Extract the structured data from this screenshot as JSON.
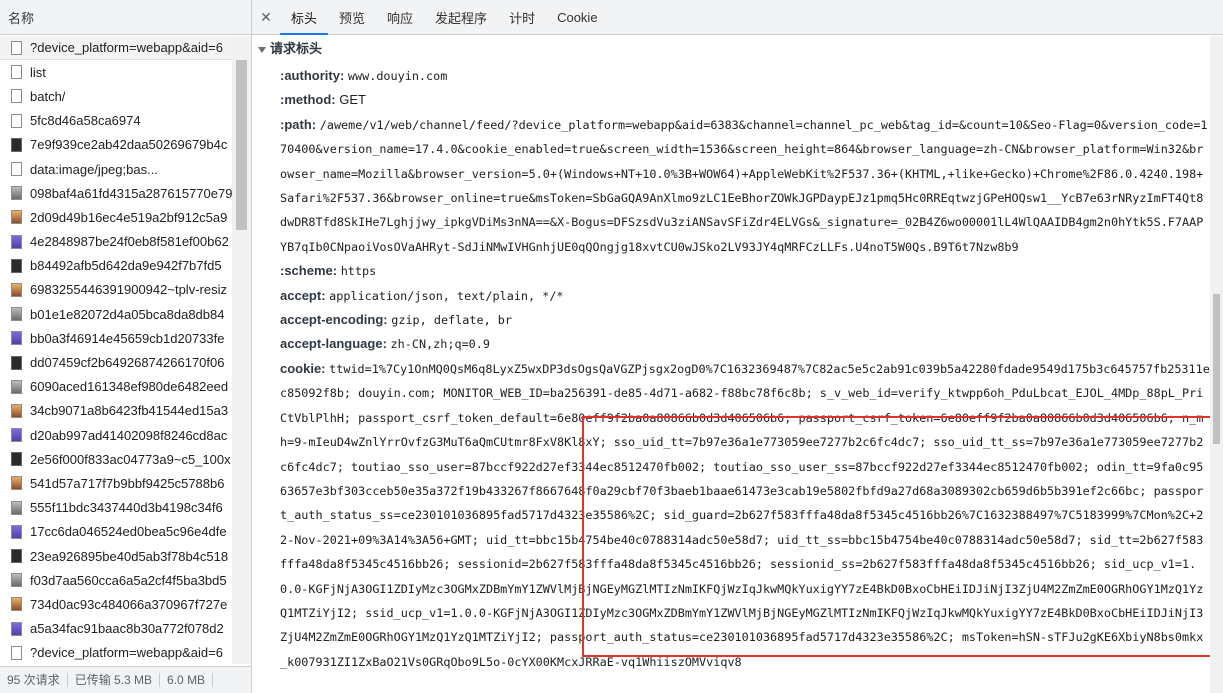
{
  "left": {
    "header": "名称",
    "requests": [
      {
        "name": "?device_platform=webapp&aid=6",
        "icon": "doc-icon"
      },
      {
        "name": "list",
        "icon": "doc-icon"
      },
      {
        "name": "batch/",
        "icon": "doc-icon"
      },
      {
        "name": "5fc8d46a58ca6974",
        "icon": "doc-icon"
      },
      {
        "name": "7e9f939ce2ab42daa50269679b4c",
        "icon": "script-icon"
      },
      {
        "name": "data:image/jpeg;bas...",
        "icon": "doc-icon"
      },
      {
        "name": "098baf4a61fd4315a287615770e79",
        "icon": "image-icon"
      },
      {
        "name": "2d09d49b16ec4e519a2bf912c5a9",
        "icon": "image-icon"
      },
      {
        "name": "4e2848987be24f0eb8f581ef00b62",
        "icon": "image-icon"
      },
      {
        "name": "b84492afb5d642da9e942f7b7fd5",
        "icon": "image-icon"
      },
      {
        "name": "6983255446391900942~tplv-resiz",
        "icon": "image-icon"
      },
      {
        "name": "b01e1e82072d4a05bca8da8db84",
        "icon": "image-icon"
      },
      {
        "name": "bb0a3f46914e45659cb1d20733fe",
        "icon": "image-icon"
      },
      {
        "name": "dd07459cf2b64926874266170f06",
        "icon": "image-icon"
      },
      {
        "name": "6090aced161348ef980de6482eed",
        "icon": "image-icon"
      },
      {
        "name": "34cb9071a8b6423fb41544ed15a3",
        "icon": "image-icon"
      },
      {
        "name": "d20ab997ad41402098f8246cd8ac",
        "icon": "image-icon"
      },
      {
        "name": "2e56f000f833ac04773a9~c5_100x",
        "icon": "image-icon"
      },
      {
        "name": "541d57a717f7b9bbf9425c5788b6",
        "icon": "image-icon"
      },
      {
        "name": "555f11bdc3437440d3b4198c34f6",
        "icon": "image-icon"
      },
      {
        "name": "17cc6da046524ed0bea5c96e4dfe",
        "icon": "image-icon"
      },
      {
        "name": "23ea926895be40d5ab3f78b4c518",
        "icon": "image-icon"
      },
      {
        "name": "f03d7aa560cca6a5a2cf4f5ba3bd5",
        "icon": "image-icon"
      },
      {
        "name": "734d0ac93c484066a370967f727e",
        "icon": "image-icon"
      },
      {
        "name": "a5a34fac91baac8b30a772f078d2",
        "icon": "image-icon"
      },
      {
        "name": "?device_platform=webapp&aid=6",
        "icon": "doc-icon"
      },
      {
        "name": "",
        "icon": "doc-icon"
      }
    ],
    "status": {
      "requests": "95 次请求",
      "transferred": "已传输 5.3 MB",
      "resources": "6.0 MB"
    }
  },
  "tabs": {
    "close": "✕",
    "items": [
      "标头",
      "预览",
      "响应",
      "发起程序",
      "计时",
      "Cookie"
    ],
    "active": "标头"
  },
  "section_title": "请求标头",
  "headers": [
    {
      "key": ":authority:",
      "value": "www.douyin.com",
      "mono": true
    },
    {
      "key": ":method:",
      "value": "GET",
      "mono": false
    },
    {
      "key": ":path:",
      "value": "/aweme/v1/web/channel/feed/?device_platform=webapp&aid=6383&channel=channel_pc_web&tag_id=&count=10&Seo-Flag=0&version_code=170400&version_name=17.4.0&cookie_enabled=true&screen_width=1536&screen_height=864&browser_language=zh-CN&browser_platform=Win32&browser_name=Mozilla&browser_version=5.0+(Windows+NT+10.0%3B+WOW64)+AppleWebKit%2F537.36+(KHTML,+like+Gecko)+Chrome%2F86.0.4240.198+Safari%2F537.36&browser_online=true&msToken=SbGaGQA9AnXlmo9zLC1EeBhorZOWkJGPDaypEJz1pmq5Hc0RREqtwzjGPeHOQsw1__YcB7e63rNRyzImFT4Qt8dwDR8Tfd8SkIHe7Lghjjwy_ipkgVDiMs3nNA==&X-Bogus=DFSzsdVu3ziANSavSFiZdr4ELVGs&_signature=_02B4Z6wo00001lL4WlQAAIDB4gm2n0hYtk5S.F7AAPYB7qIb0CNpaoiVosOVaAHRyt-SdJiNMwIVHGnhjUE0qQOngjg18xvtCU0wJSko2LV93JY4qMRFCzLLFs.U4noT5W0Qs.B9T6t7Nzw8b9",
      "mono": true
    },
    {
      "key": ":scheme:",
      "value": "https",
      "mono": true
    },
    {
      "key": "accept:",
      "value": "application/json, text/plain, */*",
      "mono": true
    },
    {
      "key": "accept-encoding:",
      "value": "gzip, deflate, br",
      "mono": true
    },
    {
      "key": "accept-language:",
      "value": "zh-CN,zh;q=0.9",
      "mono": true
    },
    {
      "key": "cookie:",
      "value": "ttwid=1%7Cy1OnMQ0QsM6q8LyxZ5wxDP3dsOgsQaVGZPjsgx2ogD0%7C1632369487%7C82ac5e5c2ab91c039b5a42280fdade9549d175b3c645757fb25311ec85092f8b; douyin.com; MONITOR_WEB_ID=ba256391-de85-4d71-a682-f88bc78f6c8b; s_v_web_id=verify_ktwpp6oh_PduLbcat_EJOL_4MDp_88pL_PriCtVblPlhH; passport_csrf_token_default=6e80eff9f2ba0a80866b0d3d406506b6; passport_csrf_token=6e80eff9f2ba0a80866b0d3d406506b6; n_mh=9-mIeuD4wZnlYrrOvfzG3MuT6aQmCUtmr8FxV8Kl8xY; sso_uid_tt=7b97e36a1e773059ee7277b2c6fc4dc7; sso_uid_tt_ss=7b97e36a1e773059ee7277b2c6fc4dc7; toutiao_sso_user=87bccf922d27ef3344ec8512470fb002; toutiao_sso_user_ss=87bccf922d27ef3344ec8512470fb002; odin_tt=9fa0c9563657e3bf303cceb50e35a372f19b433267f8667648f0a29cbf70f3baeb1baae61473e3cab19e5802fbfd9a27d68a3089302cb659d6b5b391ef2c66bc; passport_auth_status_ss=ce230101036895fad5717d4323e35586%2C; sid_guard=2b627f583fffa48da8f5345c4516bb26%7C1632388497%7C5183999%7CMon%2C+22-Nov-2021+09%3A14%3A56+GMT; uid_tt=bbc15b4754be40c0788314adc50e58d7; uid_tt_ss=bbc15b4754be40c0788314adc50e58d7; sid_tt=2b627f583fffa48da8f5345c4516bb26; sessionid=2b627f583fffa48da8f5345c4516bb26; sessionid_ss=2b627f583fffa48da8f5345c4516bb26; sid_ucp_v1=1.0.0-KGFjNjA3OGI1ZDIyMzc3OGMxZDBmYmY1ZWVlMjBjNGEyMGZlMTIzNmIKFQjWzIqJkwMQkYuxigYY7zE4BkD0BxoCbHEiIDJiNjI3ZjU4M2ZmZmE0OGRhOGY1MzQ1YzQ1MTZiYjI2; ssid_ucp_v1=1.0.0-KGFjNjA3OGI1ZDIyMzc3OGMxZDBmYmY1ZWVlMjBjNGEyMGZlMTIzNmIKFQjWzIqJkwMQkYuxigYY7zE4BkD0BxoCbHEiIDJiNjI3ZjU4M2ZmZmE0OGRhOGY1MzQ1YzQ1MTZiYjI2; passport_auth_status=ce230101036895fad5717d4323e35586%2C; msToken=hSN-sTFJu2gKE6XbiyN8bs0mkx_k007931ZI1ZxBaO21Vs0GRqObo9L5o-0cYX00KMcxJRRaE-vq1WhiiszOMVviqv8",
      "mono": true
    }
  ],
  "colors": {
    "highlight_border": "#e0342a",
    "tab_active": "#1a73e8"
  }
}
